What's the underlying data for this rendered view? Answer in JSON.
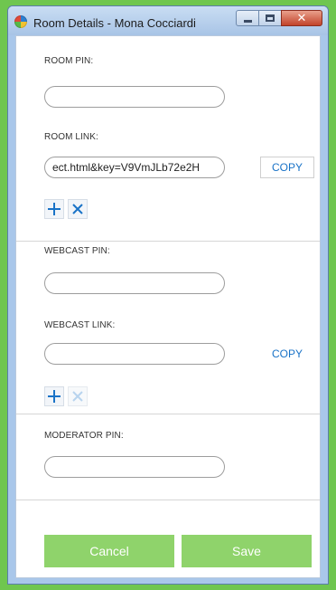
{
  "window": {
    "title": "Room Details - Mona Cocciardi",
    "close_glyph": "✕"
  },
  "room": {
    "pin_label": "ROOM PIN:",
    "pin_value": "",
    "link_label": "ROOM LINK:",
    "link_value": "ect.html&key=V9VmJLb72e2H",
    "copy_label": "COPY"
  },
  "webcast": {
    "pin_label": "WEBCAST PIN:",
    "pin_value": "",
    "link_label": "WEBCAST LINK:",
    "link_value": "",
    "copy_label": "COPY"
  },
  "moderator": {
    "pin_label": "MODERATOR PIN:",
    "pin_value": ""
  },
  "footer": {
    "cancel_label": "Cancel",
    "save_label": "Save"
  },
  "colors": {
    "accent": "#1a73c7",
    "button_green": "#8fd36b",
    "disabled_icon": "#b8d4ee"
  },
  "icons": [
    "app-logo-icon",
    "minimize-icon",
    "maximize-icon",
    "close-icon",
    "add-icon",
    "remove-icon"
  ]
}
